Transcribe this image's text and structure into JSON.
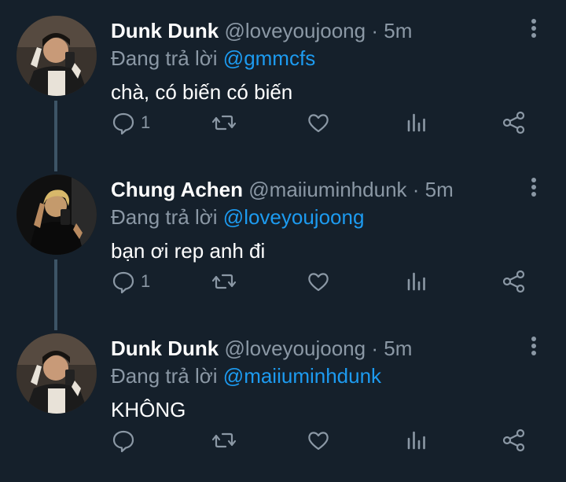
{
  "tweets": [
    {
      "name": "Dunk Dunk",
      "handle": "@loveyoujoong",
      "separator": "·",
      "time": "5m",
      "reply_prefix": "Đang trả lời",
      "reply_to": "@gmmcfs",
      "text": "chà, có biến có biến",
      "reply_count": "1",
      "avatar_icon": "person-photo-avatar"
    },
    {
      "name": "Chung Achen",
      "handle": "@maiiuminhdunk",
      "separator": "·",
      "time": "5m",
      "reply_prefix": "Đang trả lời",
      "reply_to": "@loveyoujoong",
      "text": "bạn ơi rep anh đi",
      "reply_count": "1",
      "avatar_icon": "person-photo-avatar"
    },
    {
      "name": "Dunk Dunk",
      "handle": "@loveyoujoong",
      "separator": "·",
      "time": "5m",
      "reply_prefix": "Đang trả lời",
      "reply_to": "@maiiuminhdunk",
      "text": "KHÔNG",
      "reply_count": "",
      "avatar_icon": "person-photo-avatar"
    }
  ],
  "icons": {
    "reply": "reply-icon",
    "retweet": "retweet-icon",
    "like": "like-icon",
    "analytics": "analytics-icon",
    "share": "share-icon",
    "more": "more-options-icon"
  },
  "colors": {
    "background": "#15202b",
    "secondary_text": "#8b98a5",
    "mention": "#1d9bf0",
    "thread_line": "#3d5466"
  }
}
